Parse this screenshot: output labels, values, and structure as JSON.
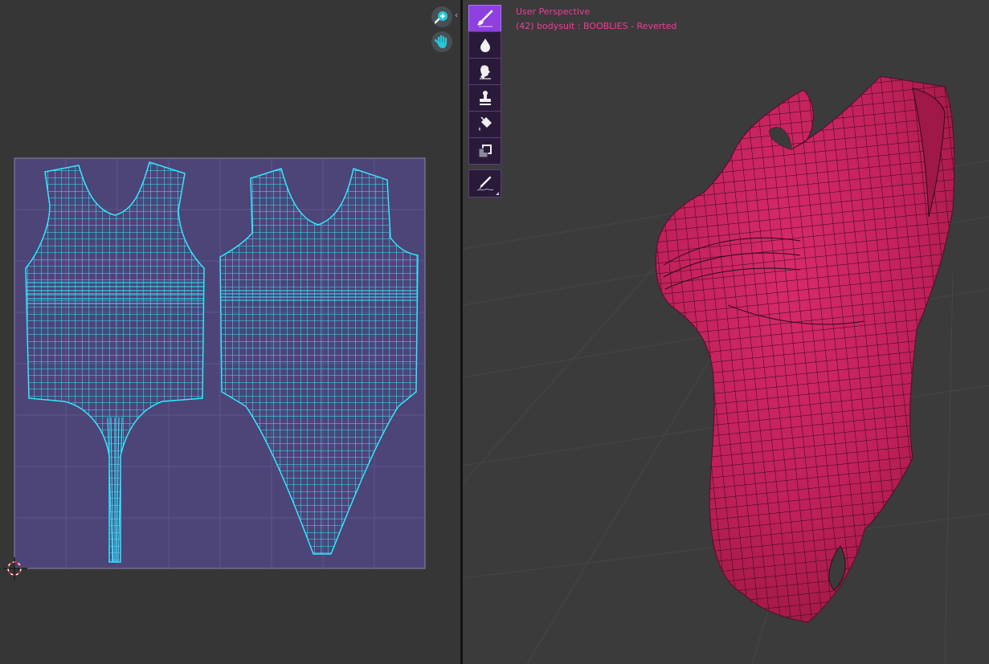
{
  "viewport": {
    "title": "User Perspective",
    "object_info": "(42) bodysuit : BOOBLIES - Reverted"
  },
  "uv_editor": {
    "nav_buttons": [
      "zoom-icon",
      "hand-pan-icon"
    ],
    "colors": {
      "uv_wire": "#33e6ff",
      "uv_bg": "#4d4478",
      "panel_bg": "#363636"
    }
  },
  "toolbar": {
    "tools": [
      "brush-icon",
      "blur-drop-icon",
      "smear-icon",
      "clone-stamp-icon",
      "fill-bucket-icon",
      "mask-icon"
    ],
    "active_tool": "brush-icon",
    "annotate_tool": "annotate-icon",
    "colors": {
      "active": "#8e3fe0",
      "inactive": "#2a1a3a"
    }
  },
  "mesh": {
    "color": "#c0205a"
  }
}
